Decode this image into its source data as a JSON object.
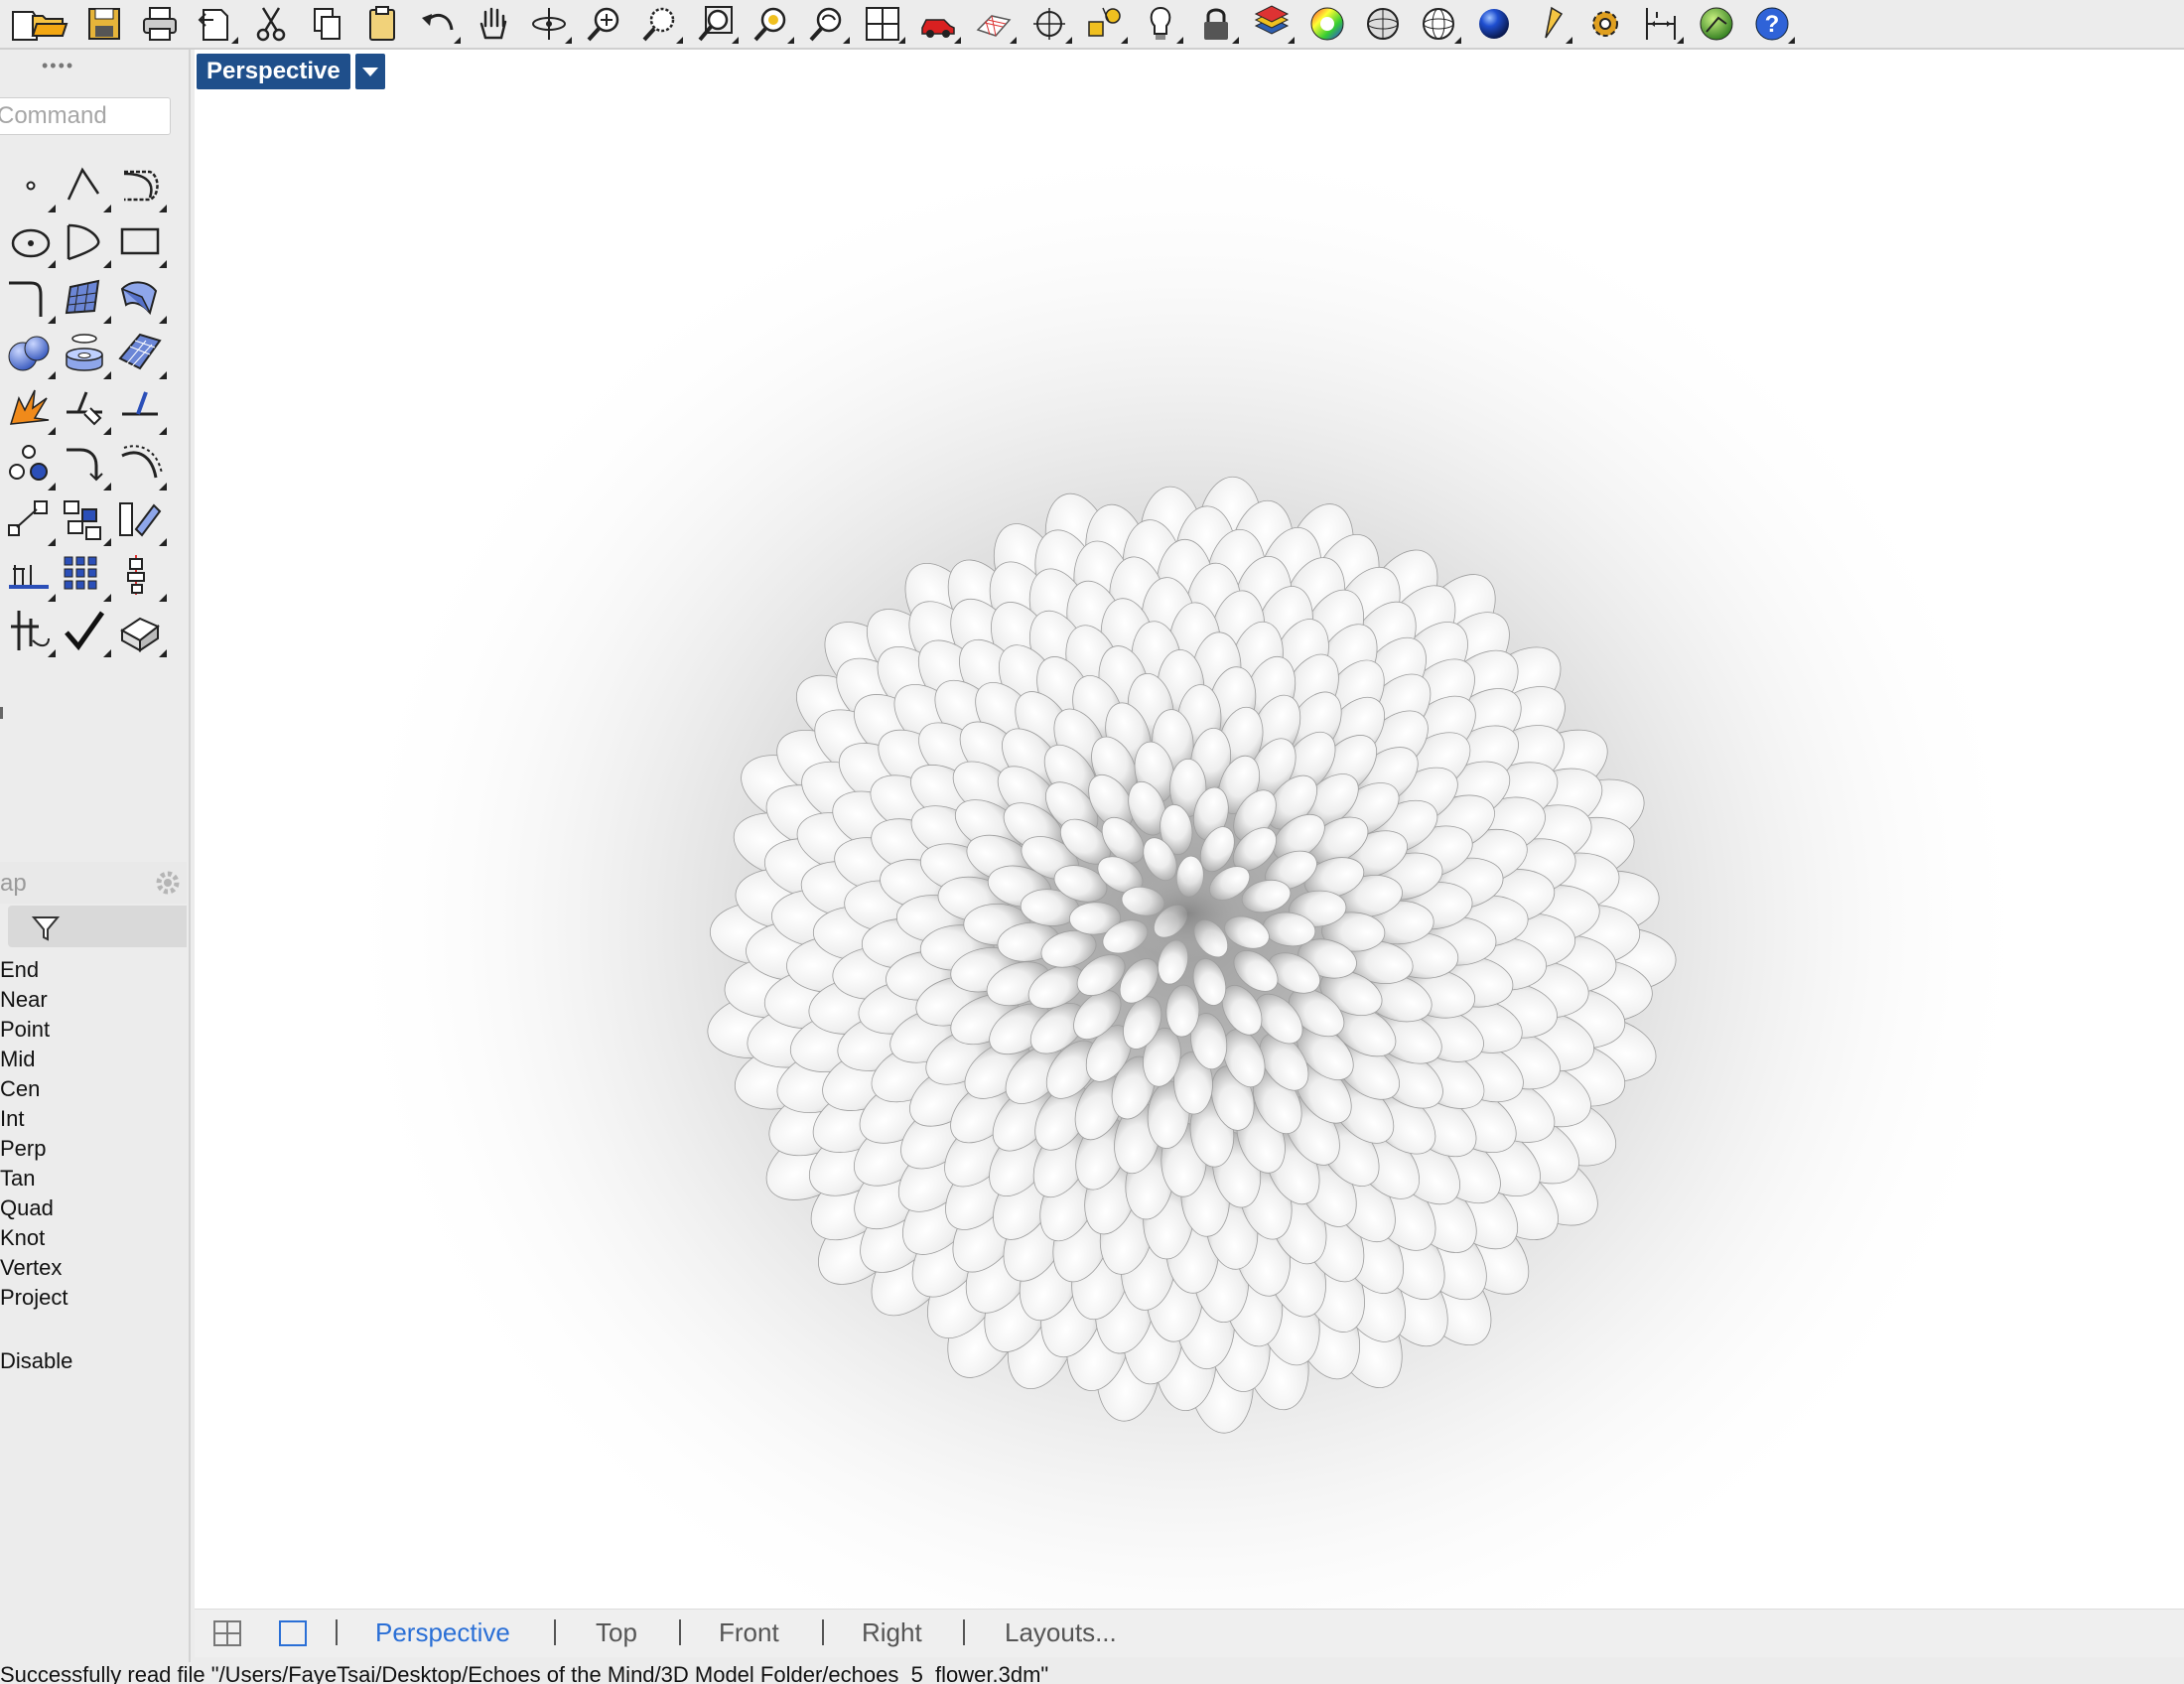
{
  "toolbar": {
    "items": [
      {
        "icon": "new-file-icon"
      },
      {
        "icon": "open-folder-icon"
      },
      {
        "icon": "save-icon"
      },
      {
        "icon": "print-icon"
      },
      {
        "icon": "import-icon"
      },
      {
        "icon": "cut-icon"
      },
      {
        "icon": "copy-icon"
      },
      {
        "icon": "paste-icon"
      },
      {
        "icon": "undo-icon"
      },
      {
        "icon": "pan-hand-icon"
      },
      {
        "icon": "rotate-view-icon"
      },
      {
        "icon": "zoom-dynamic-icon"
      },
      {
        "icon": "zoom-window-icon"
      },
      {
        "icon": "zoom-extents-icon"
      },
      {
        "icon": "zoom-selected-icon"
      },
      {
        "icon": "undo-view-icon"
      },
      {
        "icon": "viewport-layout-icon"
      },
      {
        "icon": "named-views-car-icon"
      },
      {
        "icon": "construction-plane-icon"
      },
      {
        "icon": "object-snap-icon"
      },
      {
        "icon": "select-objects-icon"
      },
      {
        "icon": "hide-lightbulb-icon"
      },
      {
        "icon": "lock-icon"
      },
      {
        "icon": "layers-icon"
      },
      {
        "icon": "color-wheel-icon"
      },
      {
        "icon": "shaded-sphere-icon"
      },
      {
        "icon": "wireframe-sphere-icon"
      },
      {
        "icon": "render-sphere-icon"
      },
      {
        "icon": "light-cone-icon"
      },
      {
        "icon": "options-gear-icon"
      },
      {
        "icon": "dimension-icon"
      },
      {
        "icon": "grasshopper-icon"
      },
      {
        "icon": "help-icon"
      }
    ]
  },
  "command": {
    "placeholder": "Command"
  },
  "tools": [
    {
      "icon": "point-icon"
    },
    {
      "icon": "polyline-icon"
    },
    {
      "icon": "curve-icon"
    },
    {
      "icon": "circle-icon"
    },
    {
      "icon": "arc-icon"
    },
    {
      "icon": "rectangle-icon"
    },
    {
      "icon": "fillet-curve-icon"
    },
    {
      "icon": "surface-corner-icon"
    },
    {
      "icon": "extrude-surface-icon"
    },
    {
      "icon": "boolean-union-icon"
    },
    {
      "icon": "cylinder-solid-icon"
    },
    {
      "icon": "surface-mesh-icon"
    },
    {
      "icon": "explode-icon"
    },
    {
      "icon": "trim-icon"
    },
    {
      "icon": "split-icon"
    },
    {
      "icon": "group-icon"
    },
    {
      "icon": "fillet-edge-icon"
    },
    {
      "icon": "offset-icon"
    },
    {
      "icon": "scale-icon"
    },
    {
      "icon": "array-icon"
    },
    {
      "icon": "mirror-icon"
    },
    {
      "icon": "dimension-tool-icon"
    },
    {
      "icon": "grid-array-icon"
    },
    {
      "icon": "align-icon"
    },
    {
      "icon": "transform-icon"
    },
    {
      "icon": "check-icon"
    },
    {
      "icon": "solid-tools-icon"
    }
  ],
  "osnap": {
    "title": "ap",
    "items": [
      "End",
      "Near",
      "Point",
      "Mid",
      "Cen",
      "Int",
      "Perp",
      "Tan",
      "Quad",
      "Knot",
      "Vertex",
      "Project"
    ],
    "disable": "Disable"
  },
  "viewport": {
    "label": "Perspective"
  },
  "tabs": {
    "items": [
      "Perspective",
      "Top",
      "Front",
      "Right",
      "Layouts..."
    ],
    "active": "Perspective"
  },
  "status": {
    "text": "Successfully read file \"/Users/FayeTsai/Desktop/Echoes of the Mind/3D Model Folder/echoes_5_flower.3dm\""
  },
  "colors": {
    "accent": "#1f4f8b",
    "tab_active": "#2a6fd6"
  }
}
